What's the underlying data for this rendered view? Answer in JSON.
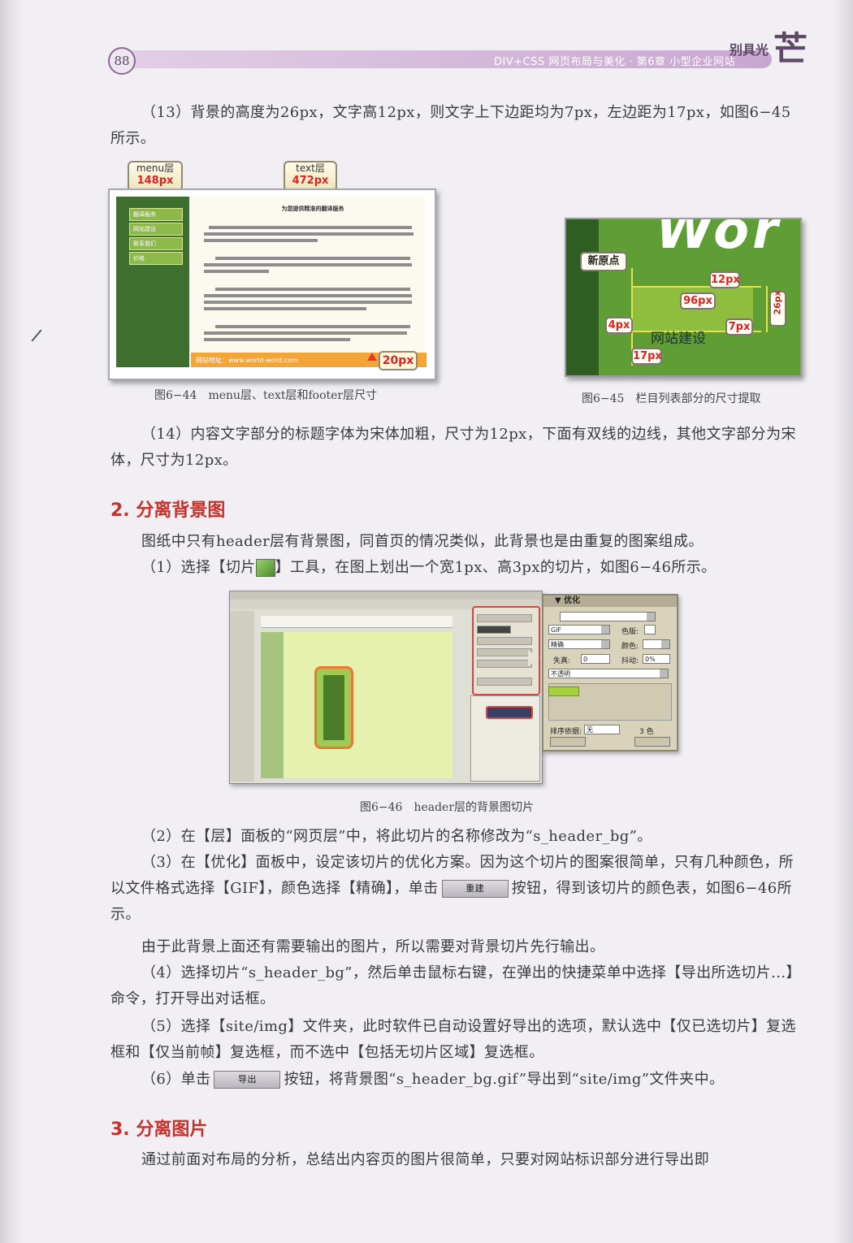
{
  "header": {
    "page_number": "88",
    "running_title": "DIV+CSS 网页布局与美化 · 第6章 小型企业网站",
    "brand": "别具光",
    "brand_big": "芒"
  },
  "paragraphs": {
    "p13": "（13）背景的高度为26px，文字高12px，则文字上下边距均为7px，左边距为17px，如图6−45所示。",
    "p14": "（14）内容文字部分的标题字体为宋体加粗，尺寸为12px，下面有双线的边线，其他文字部分为宋体，尺寸为12px。",
    "intro2": "图纸中只有header层有背景图，同首页的情况类似，此背景也是由重复的图案组成。",
    "s1_pre": "（1）选择【切片",
    "s1_post": "】工具，在图上划出一个宽1px、高3px的切片，如图6−46所示。",
    "s2": "（2）在【层】面板的“网页层”中，将此切片的名称修改为“s_header_bg”。",
    "s3_pre": "（3）在【优化】面板中，设定该切片的优化方案。因为这个切片的图案很简单，只有几种颜色，所以文件格式选择【GIF】，颜色选择【精确】，单击",
    "s3_btn": "重建",
    "s3_post": "按钮，得到该切片的颜色表，如图6−46所示。",
    "note": "由于此背景上面还有需要输出的图片，所以需要对背景切片先行输出。",
    "s4": "（4）选择切片“s_header_bg”，然后单击鼠标右键，在弹出的快捷菜单中选择【导出所选切片...】命令，打开导出对话框。",
    "s5": "（5）选择【site/img】文件夹，此时软件已自动设置好导出的选项，默认选中【仅已选切片】复选框和【仅当前帧】复选框，而不选中【包括无切片区域】复选框。",
    "s6_pre": "（6）单击",
    "s6_btn": "导出",
    "s6_post": "按钮，将背景图“s_header_bg.gif”导出到“site/img”文件夹中。",
    "intro3": "通过前面对布局的分析，总结出内容页的图片很简单，只要对网站标识部分进行导出即"
  },
  "sections": {
    "sec2": "2. 分离背景图",
    "sec3": "3. 分离图片"
  },
  "captions": {
    "fig44": "图6−44　menu层、text层和footer层尺寸",
    "fig45": "图6−45　栏目列表部分的尺寸提取",
    "fig46": "图6−46　header层的背景图切片"
  },
  "fig44": {
    "menu_tag_name": "menu层",
    "menu_tag_size": "148px",
    "text_tag_name": "text层",
    "text_tag_size": "472px",
    "footer_tag": "20px",
    "title": "为您提供精准的翻译服务",
    "menu_items": [
      "翻译服务",
      "网站建设",
      "联系我们",
      "价格"
    ],
    "footer_text": "网站地址：www.world-word.com"
  },
  "fig45": {
    "origin": "新原点",
    "px12": "12px",
    "px96": "96px",
    "px26": "26px",
    "px4": "4px",
    "px7": "7px",
    "px17": "17px",
    "item_text": "网站建设"
  },
  "fig46_panel": {
    "title": "▼ 优化",
    "format": "GIF",
    "palette": "精确",
    "color_label": "色版:",
    "colors_label": "颜色:",
    "loss_label": "失真:",
    "loss_value": "0",
    "dither_label": "抖动:",
    "dither_value": "0%",
    "transparency": "不透明",
    "sort_label": "排序依据:",
    "sort_value": "无",
    "count": "3 色"
  }
}
